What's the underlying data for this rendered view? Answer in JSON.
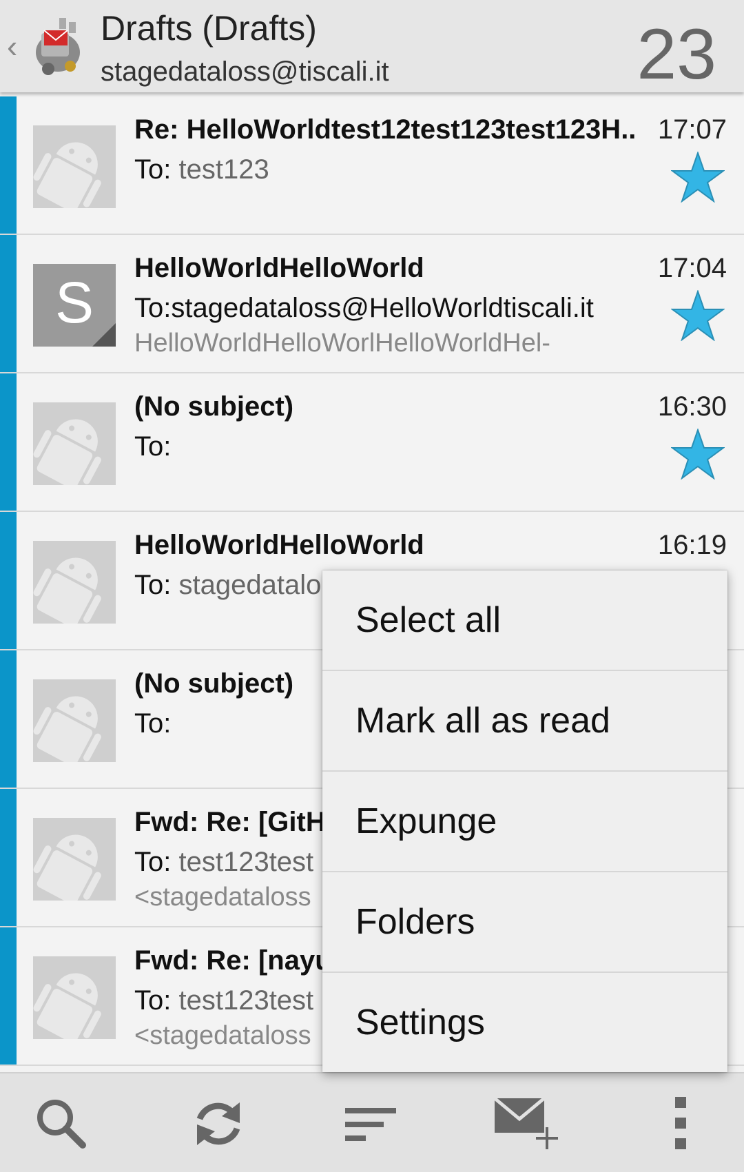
{
  "header": {
    "back": "‹",
    "title": "Drafts (Drafts)",
    "account": "stagedataloss@tiscali.it",
    "count": "23",
    "app_icon": "k9-mail-icon"
  },
  "messages": [
    {
      "subject": "Re: HelloWorldtest12test123test123H..",
      "to_label": "To: ",
      "to_value": "test123",
      "preview": "",
      "time": "17:07",
      "starred": true,
      "avatar": "android"
    },
    {
      "subject": "HelloWorldHelloWorld",
      "to_label": "To:",
      "to_value": "stagedataloss@HelloWorldtiscali.it",
      "preview": "HelloWorldHelloWorlHelloWorldHel-",
      "time": "17:04",
      "starred": true,
      "avatar": "letter",
      "avatar_letter": "S"
    },
    {
      "subject": "(No subject)",
      "to_label": "To:",
      "to_value": "",
      "preview": "",
      "time": "16:30",
      "starred": true,
      "avatar": "android"
    },
    {
      "subject": "HelloWorldHelloWorld",
      "to_label": "To: ",
      "to_value": "stagedatalo",
      "preview": "",
      "time": "16:19",
      "starred": false,
      "avatar": "android"
    },
    {
      "subject": "(No subject)",
      "to_label": "To:",
      "to_value": "",
      "preview": "",
      "time": "",
      "starred": false,
      "avatar": "android"
    },
    {
      "subject": "Fwd: Re: [GitHu",
      "to_label": "To: ",
      "to_value": "test123test",
      "preview": "<stagedataloss",
      "time": "",
      "starred": false,
      "avatar": "android"
    },
    {
      "subject": "Fwd: Re: [nayu",
      "to_label": "To: ",
      "to_value": "test123test",
      "preview": "<stagedataloss",
      "time": "",
      "starred": false,
      "avatar": "android"
    }
  ],
  "menu": {
    "items": [
      "Select all",
      "Mark all as read",
      "Expunge",
      "Folders",
      "Settings"
    ]
  },
  "bottom_bar": {
    "buttons": [
      "search-icon",
      "refresh-icon",
      "sort-icon",
      "compose-icon",
      "overflow-menu-icon"
    ]
  },
  "colors": {
    "accent_bar": "#0b95c9",
    "star": "#33b5e5",
    "header_bg": "#e6e6e6"
  }
}
